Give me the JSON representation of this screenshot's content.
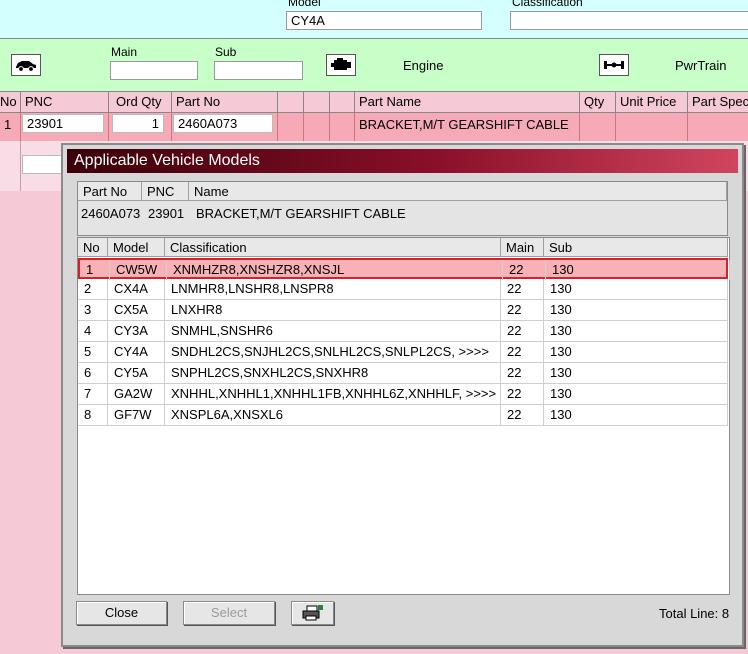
{
  "top": {
    "model_label": "Model",
    "model_value": "CY4A",
    "classification_label": "Classification",
    "classification_value": ""
  },
  "bar": {
    "main_label": "Main",
    "sub_label": "Sub",
    "engine_label": "Engine",
    "pwrtrain_label": "PwrTrain"
  },
  "grid": {
    "headers": [
      "No",
      "PNC",
      "Ord Qty",
      "Part No",
      "",
      "",
      "",
      "Part Name",
      "Qty",
      "Unit Price",
      "Part Spec"
    ],
    "row": {
      "no": "1",
      "pnc": "23901",
      "ord_qty": "1",
      "part_no": "2460A073",
      "part_name": "BRACKET,M/T GEARSHIFT CABLE"
    }
  },
  "dialog": {
    "title": "Applicable Vehicle Models",
    "part_headers": {
      "part_no": "Part No",
      "pnc": "PNC",
      "name": "Name"
    },
    "part": {
      "part_no": "2460A073",
      "pnc": "23901",
      "name": "BRACKET,M/T GEARSHIFT CABLE"
    },
    "table_headers": {
      "no": "No",
      "model": "Model",
      "classification": "Classification",
      "main": "Main",
      "sub": "Sub"
    },
    "rows": [
      {
        "no": "1",
        "model": "CW5W",
        "classification": "XNMHZR8,XNSHZR8,XNSJL",
        "main": "22",
        "sub": "130"
      },
      {
        "no": "2",
        "model": "CX4A",
        "classification": "LNMHR8,LNSHR8,LNSPR8",
        "main": "22",
        "sub": "130"
      },
      {
        "no": "3",
        "model": "CX5A",
        "classification": "LNXHR8",
        "main": "22",
        "sub": "130"
      },
      {
        "no": "4",
        "model": "CY3A",
        "classification": "SNMHL,SNSHR6",
        "main": "22",
        "sub": "130"
      },
      {
        "no": "5",
        "model": "CY4A",
        "classification": "SNDHL2CS,SNJHL2CS,SNLHL2CS,SNLPL2CS,  >>>>",
        "main": "22",
        "sub": "130"
      },
      {
        "no": "6",
        "model": "CY5A",
        "classification": "SNPHL2CS,SNXHL2CS,SNXHR8",
        "main": "22",
        "sub": "130"
      },
      {
        "no": "7",
        "model": "GA2W",
        "classification": "XNHHL,XNHHL1,XNHHL1FB,XNHHL6Z,XNHHLF,  >>>>",
        "main": "22",
        "sub": "130"
      },
      {
        "no": "8",
        "model": "GF7W",
        "classification": "XNSPL6A,XNSXL6",
        "main": "22",
        "sub": "130"
      }
    ],
    "selected_row": 1,
    "close_label": "Close",
    "select_label": "Select",
    "total_text": "Total Line: 8"
  }
}
